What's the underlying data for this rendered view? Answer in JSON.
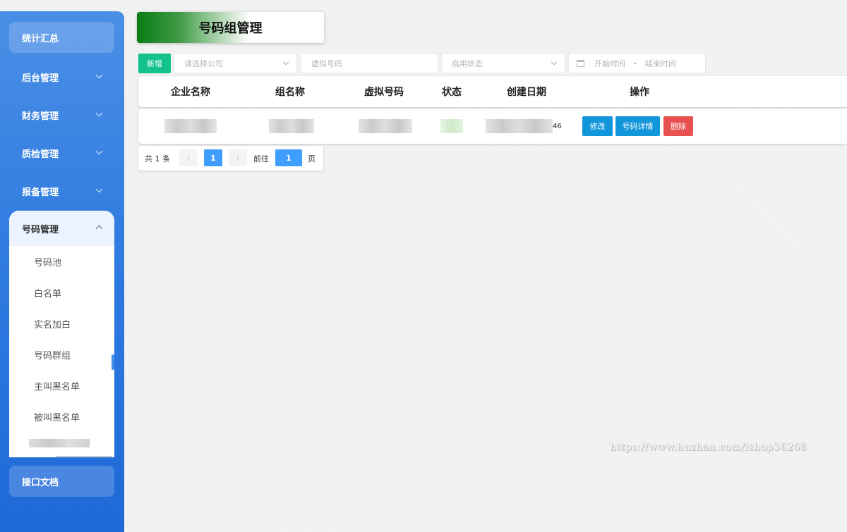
{
  "sidebar": {
    "top_item": "统计汇总",
    "items": [
      {
        "label": "后台管理"
      },
      {
        "label": "财务管理"
      },
      {
        "label": "质检管理"
      },
      {
        "label": "报备管理"
      }
    ],
    "expanded": {
      "label": "号码管理",
      "children": [
        "号码池",
        "白名单",
        "实名加白",
        "号码群组",
        "主叫黑名单",
        "被叫黑名单"
      ]
    },
    "bottom_item": "接口文档"
  },
  "page": {
    "title": "号码组管理"
  },
  "filters": {
    "add_label": "新增",
    "company_placeholder": "请选择公司",
    "virtual_number_placeholder": "虚拟号码",
    "status_placeholder": "启用状态",
    "start_time_placeholder": "开始时间",
    "range_separator": "-",
    "end_time_placeholder": "结束时间"
  },
  "table": {
    "columns": [
      "企业名称",
      "组名称",
      "虚拟号码",
      "状态",
      "创建日期",
      "操作"
    ],
    "rows": [
      {
        "date_suffix": "46"
      }
    ],
    "actions": [
      "修改",
      "号码详情",
      "删除"
    ]
  },
  "pagination": {
    "total_text": "共 1 条",
    "prev_icon": "‹",
    "current_page": "1",
    "next_icon": "›",
    "goto_label": "前往",
    "goto_value": "1",
    "page_unit": "页"
  },
  "watermark": "https://www.huzhan.com/ishop36268",
  "colors": {
    "sidebar": "#2f7ae0",
    "add_button": "#13c28a",
    "edit_button": "#1296db",
    "delete_button": "#e8504f",
    "pager_active": "#409eff"
  }
}
